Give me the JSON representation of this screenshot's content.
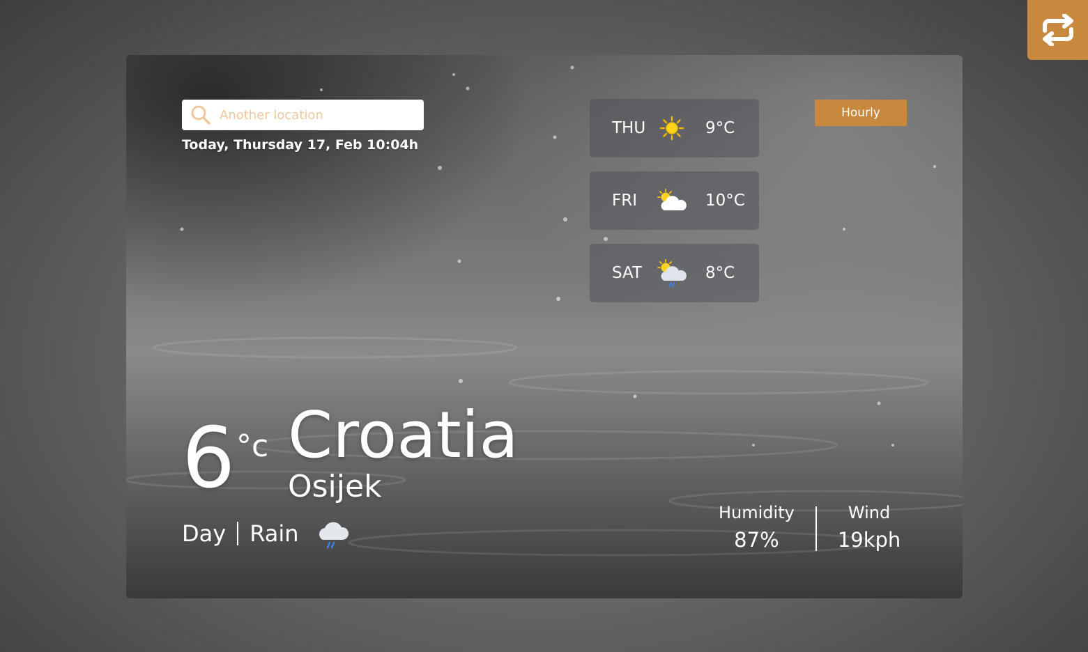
{
  "search": {
    "placeholder": "Another location"
  },
  "date": "Today, Thursday 17, Feb 10:04h",
  "forecast": [
    {
      "day": "THU",
      "icon": "sun-icon",
      "temp": "9°C"
    },
    {
      "day": "FRI",
      "icon": "partly-cloudy-icon",
      "temp": "10°C"
    },
    {
      "day": "SAT",
      "icon": "partly-cloudy-rain-icon",
      "temp": "8°C"
    }
  ],
  "hourly_label": "Hourly",
  "current": {
    "temp": "6",
    "unit": "°c",
    "country": "Croatia",
    "city": "Osijek",
    "period": "Day",
    "condition": "Rain",
    "icon": "rain-cloud-icon"
  },
  "stats": {
    "humidity_label": "Humidity",
    "humidity": "87%",
    "wind_label": "Wind",
    "wind": "19kph"
  },
  "colors": {
    "accent": "#c8893f",
    "rain": "#3b82f6"
  }
}
